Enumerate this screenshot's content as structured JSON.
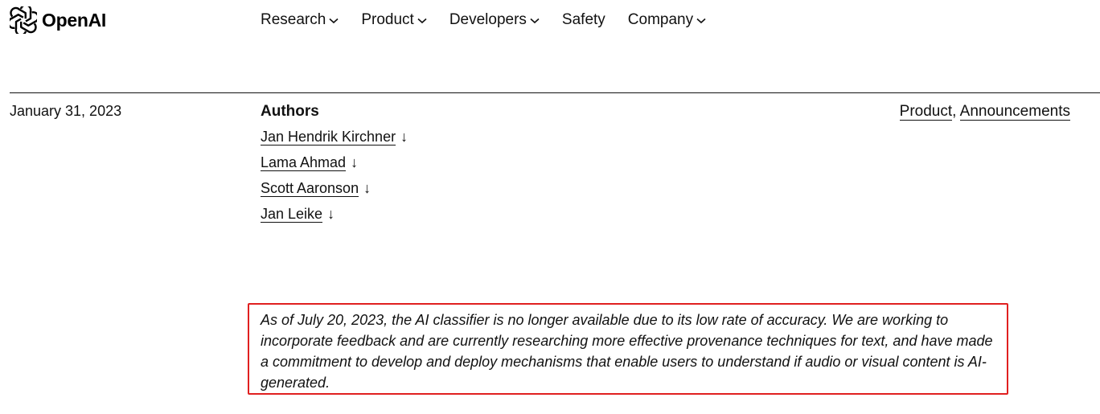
{
  "header": {
    "logo_text": "OpenAI",
    "logo_icon": "openai-logo-icon",
    "nav": [
      {
        "label": "Research",
        "has_dropdown": true
      },
      {
        "label": "Product",
        "has_dropdown": true
      },
      {
        "label": "Developers",
        "has_dropdown": true
      },
      {
        "label": "Safety",
        "has_dropdown": false
      },
      {
        "label": "Company",
        "has_dropdown": true
      }
    ]
  },
  "meta": {
    "date": "January 31, 2023",
    "authors_heading": "Authors",
    "authors": [
      {
        "name": "Jan Hendrik Kirchner",
        "arrow": "↓"
      },
      {
        "name": "Lama Ahmad",
        "arrow": "↓"
      },
      {
        "name": "Scott Aaronson",
        "arrow": "↓"
      },
      {
        "name": "Jan Leike",
        "arrow": "↓"
      }
    ],
    "tags": [
      "Product",
      "Announcements"
    ],
    "tag_separator": ", "
  },
  "notice": {
    "text": "As of July 20, 2023, the AI classifier is no longer available due to its low rate of accuracy. We are working to incorporate feedback and are currently researching more effective provenance techniques for text, and have made a commitment to develop and deploy mechanisms that enable users to understand if audio or visual content is AI-generated.",
    "border_color": "#e02020"
  }
}
